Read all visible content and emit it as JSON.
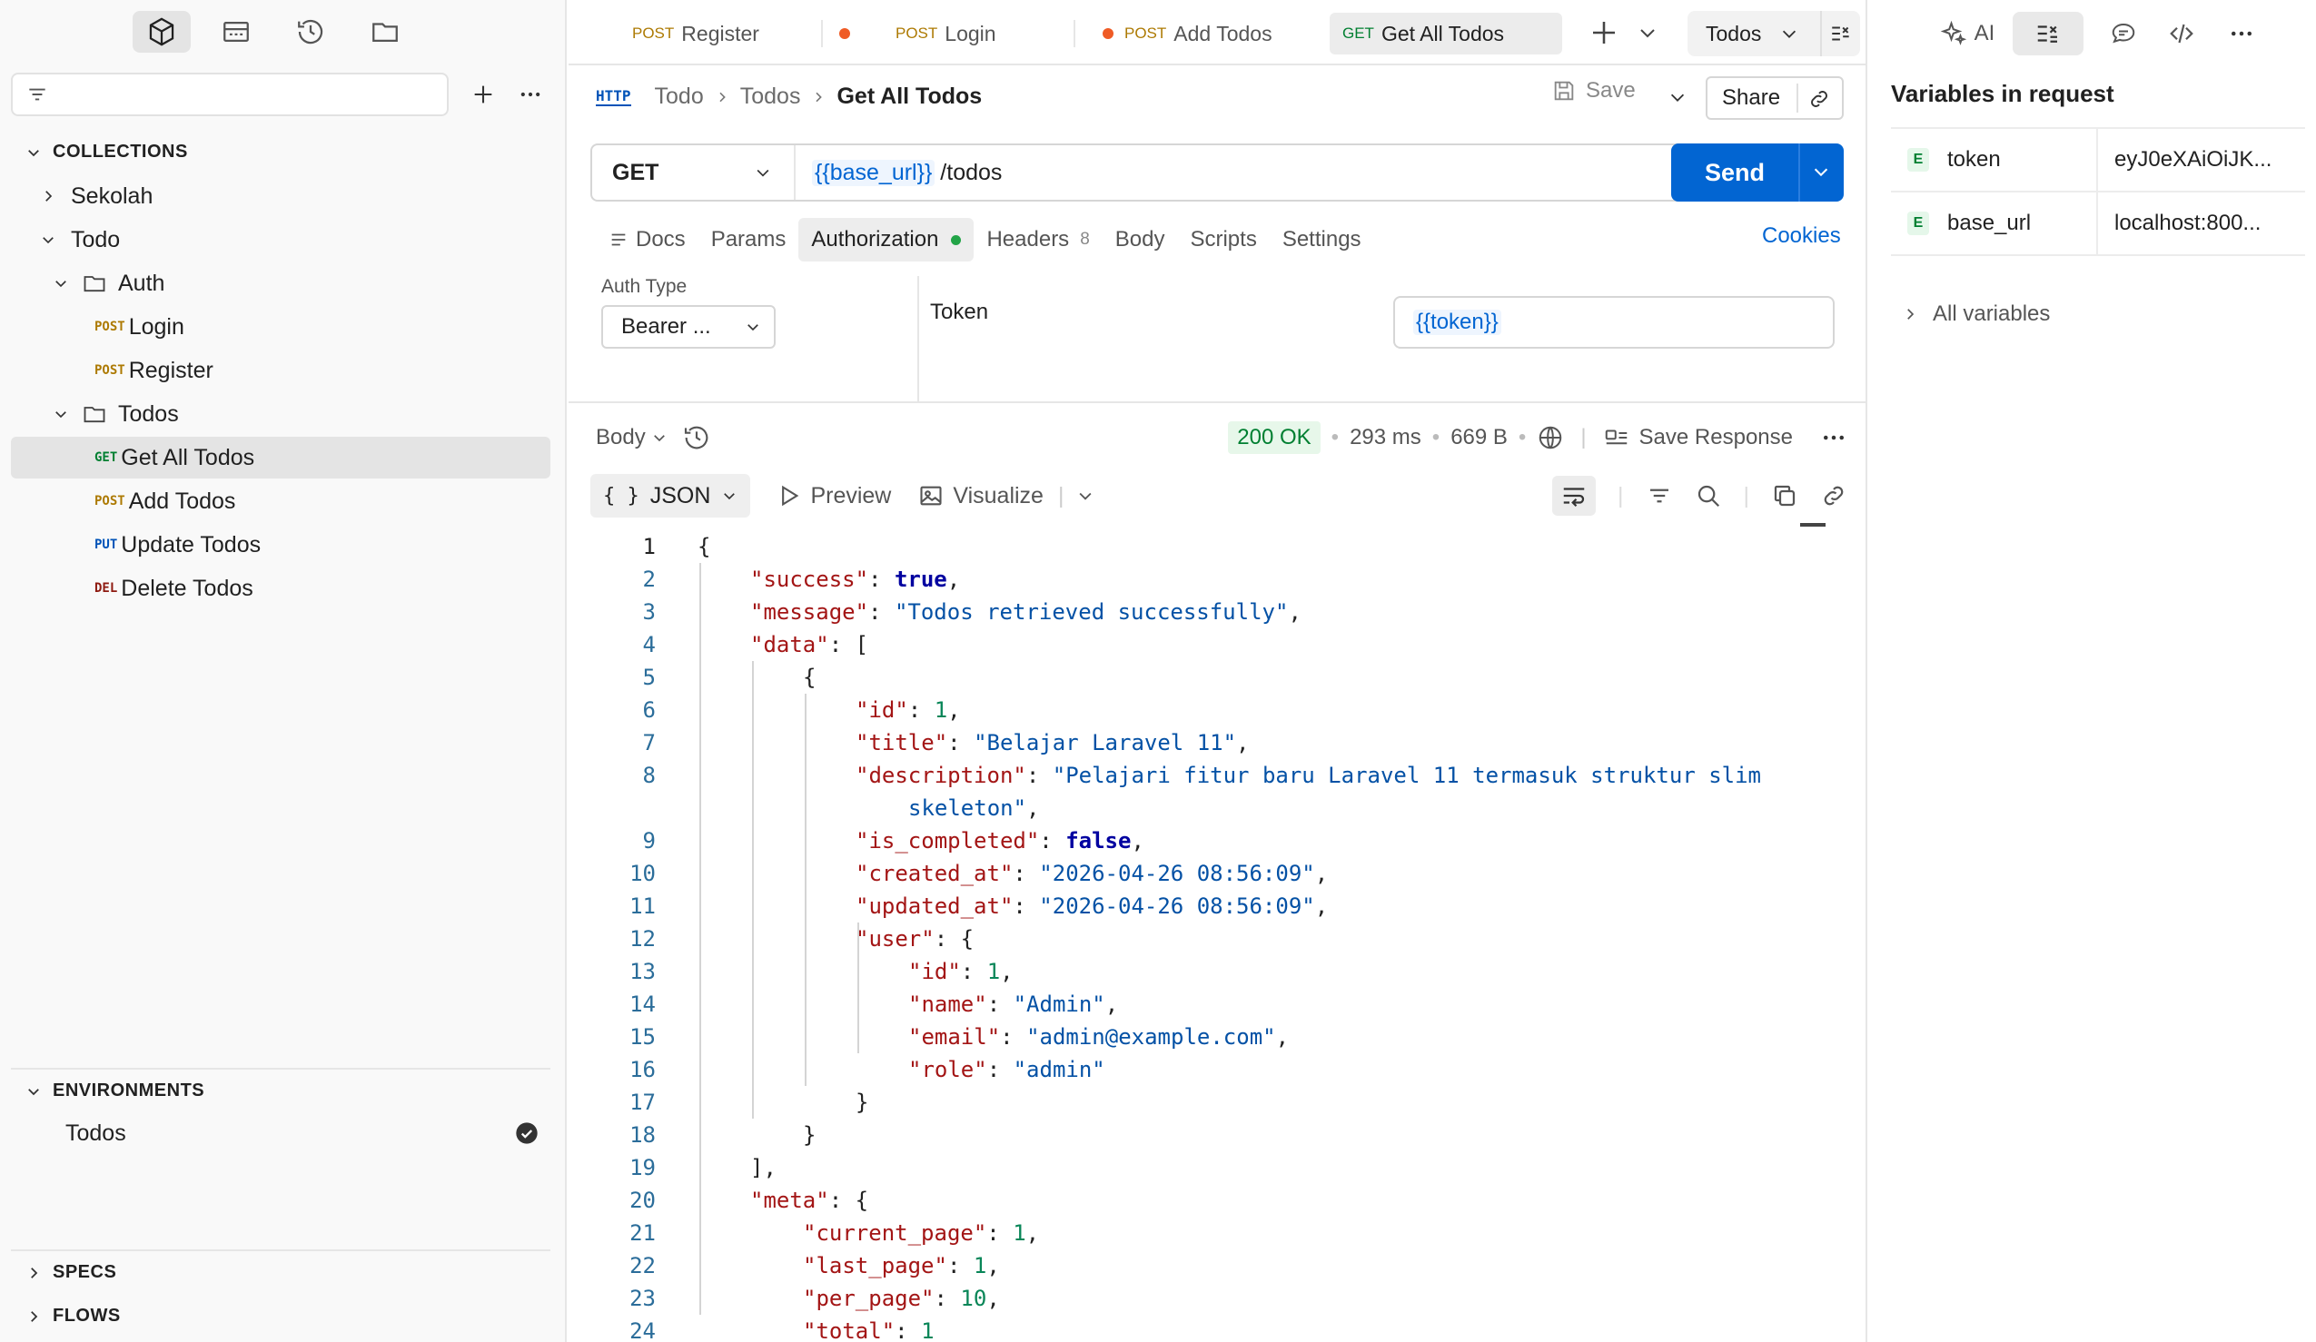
{
  "sidebar": {
    "collections_heading": "COLLECTIONS",
    "tree": [
      {
        "label": "Sekolah"
      },
      {
        "label": "Todo"
      },
      {
        "label": "Auth"
      },
      {
        "method": "POST",
        "label": "Login"
      },
      {
        "method": "POST",
        "label": "Register"
      },
      {
        "label": "Todos"
      },
      {
        "method": "GET",
        "label": "Get All Todos"
      },
      {
        "method": "POST",
        "label": "Add Todos"
      },
      {
        "method": "PUT",
        "label": "Update Todos"
      },
      {
        "method": "DEL",
        "label": "Delete Todos"
      }
    ],
    "environments_heading": "ENVIRONMENTS",
    "environments": [
      {
        "label": "Todos"
      }
    ],
    "specs_heading": "SPECS",
    "flows_heading": "FLOWS"
  },
  "tabs": {
    "items": [
      {
        "method": "POST",
        "label": "Register"
      },
      {
        "method": "POST",
        "label": "Login"
      },
      {
        "method": "POST",
        "label": "Add Todos"
      },
      {
        "method": "GET",
        "label": "Get All Todos"
      }
    ],
    "environment": "Todos"
  },
  "request": {
    "protocol_badge": "HTTP",
    "breadcrumb": [
      "Todo",
      "Todos",
      "Get All Todos"
    ],
    "save_label": "Save",
    "share_label": "Share",
    "method": "GET",
    "url_variable": "{{base_url}}",
    "url_path": "/todos",
    "send_label": "Send",
    "tabs": {
      "docs": "Docs",
      "params": "Params",
      "authorization": "Authorization",
      "headers": "Headers",
      "headers_count": "8",
      "body": "Body",
      "scripts": "Scripts",
      "settings": "Settings"
    },
    "cookies_label": "Cookies",
    "auth": {
      "type_label": "Auth Type",
      "type_value": "Bearer ...",
      "token_label": "Token",
      "token_value": "{{token}}"
    }
  },
  "response": {
    "body_label": "Body",
    "status": "200 OK",
    "time": "293 ms",
    "size": "669 B",
    "save_response": "Save Response",
    "format": "JSON",
    "preview_label": "Preview",
    "visualize_label": "Visualize"
  },
  "code_lines": [
    {
      "n": "1",
      "indent": 0,
      "parts": [
        [
          "p",
          "{"
        ]
      ]
    },
    {
      "n": "2",
      "indent": 1,
      "parts": [
        [
          "k",
          "\"success\""
        ],
        [
          "p",
          ": "
        ],
        [
          "b",
          "true"
        ],
        [
          "p",
          ","
        ]
      ]
    },
    {
      "n": "3",
      "indent": 1,
      "parts": [
        [
          "k",
          "\"message\""
        ],
        [
          "p",
          ": "
        ],
        [
          "s",
          "\"Todos retrieved successfully\""
        ],
        [
          "p",
          ","
        ]
      ]
    },
    {
      "n": "4",
      "indent": 1,
      "parts": [
        [
          "k",
          "\"data\""
        ],
        [
          "p",
          ": ["
        ]
      ]
    },
    {
      "n": "5",
      "indent": 2,
      "parts": [
        [
          "p",
          "{"
        ]
      ]
    },
    {
      "n": "6",
      "indent": 3,
      "parts": [
        [
          "k",
          "\"id\""
        ],
        [
          "p",
          ": "
        ],
        [
          "n",
          "1"
        ],
        [
          "p",
          ","
        ]
      ]
    },
    {
      "n": "7",
      "indent": 3,
      "parts": [
        [
          "k",
          "\"title\""
        ],
        [
          "p",
          ": "
        ],
        [
          "s",
          "\"Belajar Laravel 11\""
        ],
        [
          "p",
          ","
        ]
      ]
    },
    {
      "n": "8",
      "indent": 3,
      "parts": [
        [
          "k",
          "\"description\""
        ],
        [
          "p",
          ": "
        ],
        [
          "s",
          "\"Pelajari fitur baru Laravel 11 termasuk struktur slim"
        ]
      ]
    },
    {
      "n": "",
      "indent": 4,
      "parts": [
        [
          "s",
          "skeleton\""
        ],
        [
          "p",
          ","
        ]
      ]
    },
    {
      "n": "9",
      "indent": 3,
      "parts": [
        [
          "k",
          "\"is_completed\""
        ],
        [
          "p",
          ": "
        ],
        [
          "b",
          "false"
        ],
        [
          "p",
          ","
        ]
      ]
    },
    {
      "n": "10",
      "indent": 3,
      "parts": [
        [
          "k",
          "\"created_at\""
        ],
        [
          "p",
          ": "
        ],
        [
          "s",
          "\"2026-04-26 08:56:09\""
        ],
        [
          "p",
          ","
        ]
      ]
    },
    {
      "n": "11",
      "indent": 3,
      "parts": [
        [
          "k",
          "\"updated_at\""
        ],
        [
          "p",
          ": "
        ],
        [
          "s",
          "\"2026-04-26 08:56:09\""
        ],
        [
          "p",
          ","
        ]
      ]
    },
    {
      "n": "12",
      "indent": 3,
      "parts": [
        [
          "k",
          "\"user\""
        ],
        [
          "p",
          ": {"
        ]
      ]
    },
    {
      "n": "13",
      "indent": 4,
      "parts": [
        [
          "k",
          "\"id\""
        ],
        [
          "p",
          ": "
        ],
        [
          "n",
          "1"
        ],
        [
          "p",
          ","
        ]
      ]
    },
    {
      "n": "14",
      "indent": 4,
      "parts": [
        [
          "k",
          "\"name\""
        ],
        [
          "p",
          ": "
        ],
        [
          "s",
          "\"Admin\""
        ],
        [
          "p",
          ","
        ]
      ]
    },
    {
      "n": "15",
      "indent": 4,
      "parts": [
        [
          "k",
          "\"email\""
        ],
        [
          "p",
          ": "
        ],
        [
          "s",
          "\"admin@example.com\""
        ],
        [
          "p",
          ","
        ]
      ]
    },
    {
      "n": "16",
      "indent": 4,
      "parts": [
        [
          "k",
          "\"role\""
        ],
        [
          "p",
          ": "
        ],
        [
          "s",
          "\"admin\""
        ]
      ]
    },
    {
      "n": "17",
      "indent": 3,
      "parts": [
        [
          "p",
          "}"
        ]
      ]
    },
    {
      "n": "18",
      "indent": 2,
      "parts": [
        [
          "p",
          "}"
        ]
      ]
    },
    {
      "n": "19",
      "indent": 1,
      "parts": [
        [
          "p",
          "],"
        ]
      ]
    },
    {
      "n": "20",
      "indent": 1,
      "parts": [
        [
          "k",
          "\"meta\""
        ],
        [
          "p",
          ": {"
        ]
      ]
    },
    {
      "n": "21",
      "indent": 2,
      "parts": [
        [
          "k",
          "\"current_page\""
        ],
        [
          "p",
          ": "
        ],
        [
          "n",
          "1"
        ],
        [
          "p",
          ","
        ]
      ]
    },
    {
      "n": "22",
      "indent": 2,
      "parts": [
        [
          "k",
          "\"last_page\""
        ],
        [
          "p",
          ": "
        ],
        [
          "n",
          "1"
        ],
        [
          "p",
          ","
        ]
      ]
    },
    {
      "n": "23",
      "indent": 2,
      "parts": [
        [
          "k",
          "\"per_page\""
        ],
        [
          "p",
          ": "
        ],
        [
          "n",
          "10"
        ],
        [
          "p",
          ","
        ]
      ]
    },
    {
      "n": "24",
      "indent": 2,
      "parts": [
        [
          "k",
          "\"total\""
        ],
        [
          "p",
          ": "
        ],
        [
          "n",
          "1"
        ]
      ]
    }
  ],
  "right_panel": {
    "ai_label": "AI",
    "title": "Variables in request",
    "variables": [
      {
        "scope": "E",
        "name": "token",
        "value": "eyJ0eXAiOiJK..."
      },
      {
        "scope": "E",
        "name": "base_url",
        "value": "localhost:800..."
      }
    ],
    "all_variables_label": "All variables"
  },
  "colors": {
    "accent": "#0265d2",
    "get": "#007f31",
    "post": "#ad7a03",
    "put": "#0053b8",
    "del": "#8e1a10",
    "unsaved_dot": "#ef5b25",
    "status_ok": "#007f31"
  },
  "icons": [
    "cube-icon",
    "layout-icon",
    "history-icon",
    "folder-icon",
    "filter-icon",
    "plus-icon",
    "more-icon",
    "chevron-down-icon",
    "chevron-right-icon",
    "folder-icon",
    "check-circle-icon",
    "save-icon",
    "link-icon",
    "doc-icon",
    "globe-icon",
    "example-icon",
    "play-icon",
    "image-icon",
    "wrap-icon",
    "filter-icon",
    "search-icon",
    "copy-icon",
    "sparkle-icon",
    "variables-icon",
    "comment-icon",
    "code-icon"
  ]
}
